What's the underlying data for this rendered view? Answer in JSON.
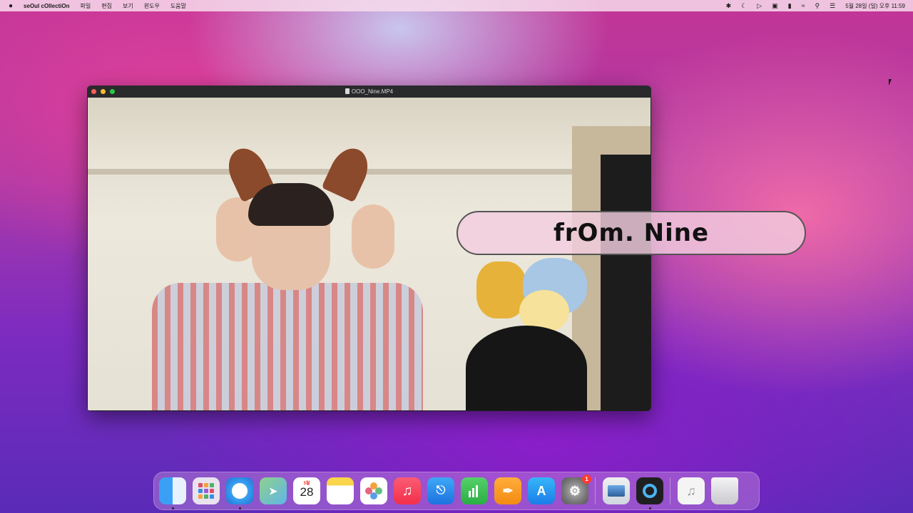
{
  "menubar": {
    "apple": "",
    "app_name": "seOul cOllectiOn",
    "menus": [
      "파일",
      "편집",
      "보기",
      "윈도우",
      "도움말"
    ],
    "clock": "5월 28일 (일) 오후 11:59"
  },
  "window": {
    "title": "OOO_Nine.MP4"
  },
  "caption": {
    "text": "frOm. Nine"
  },
  "dock": {
    "calendar_month": "5월",
    "calendar_day": "28",
    "settings_badge": "1",
    "items": [
      "finder",
      "launchpad",
      "safari",
      "maps",
      "calendar",
      "notes",
      "photos",
      "music",
      "keynote",
      "numbers",
      "pages",
      "app-store",
      "system-settings",
      "preview",
      "quicktime",
      "music-file",
      "trash"
    ]
  },
  "colors": {
    "accent_caption_bg": "#f2cdde",
    "badge": "#ff3b30"
  }
}
